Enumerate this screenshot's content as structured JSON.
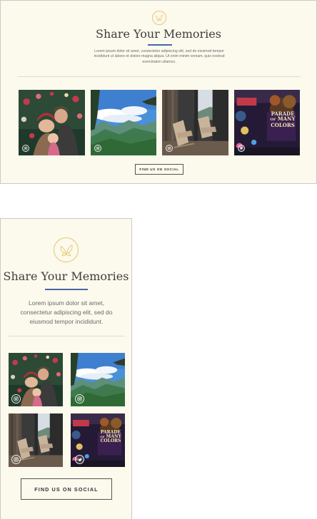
{
  "section": {
    "title": "Share Your Memories",
    "desktop_description": "Lorem ipsum dolor sit amet, consectetur adipiscing elit, sed do eiusmod tempor incididunt ut labore et dolore magna aliqua. Ut enim minim veniam, quis nostrud exercitation ullamco.",
    "mobile_description": "Lorem ipsum dolor sit amet, consectetur adipiscing elit, sed do eiusmod tempor incididunt.",
    "button_label": "FIND US ON SOCIAL"
  },
  "logo_icon": "butterfly-icon",
  "colors": {
    "background": "#fcf9ed",
    "accent_line": "#4a66a8",
    "logo_gold": "#e3c873",
    "text": "#3d3d3d"
  },
  "photos": [
    {
      "subject": "family-christmas-tree",
      "badge_icon": "instagram-icon"
    },
    {
      "subject": "smoky-mountains-view",
      "badge_icon": "instagram-icon"
    },
    {
      "subject": "balcony-rocking-chairs",
      "badge_icon": "instagram-icon"
    },
    {
      "subject": "parade-of-many-colors",
      "badge_icon": "twitter-icon",
      "sign_lines": [
        "PARADE",
        "OF",
        "MANY",
        "COLORS"
      ]
    }
  ]
}
